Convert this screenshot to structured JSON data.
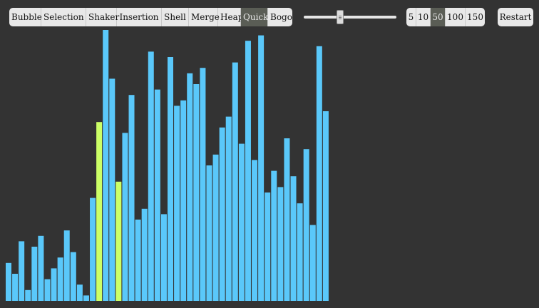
{
  "algorithms": [
    "Bubble",
    "Selection",
    "Shaker",
    "Insertion",
    "Shell",
    "Merge",
    "Heap",
    "Quick",
    "Bogo"
  ],
  "active_algorithm": "Quick",
  "sizes": [
    "5",
    "10",
    "50",
    "100",
    "150"
  ],
  "active_size": "50",
  "restart_label": "Restart",
  "speed_fraction": 0.39,
  "colors": {
    "background": "#333333",
    "bar": "#5ac8fa",
    "bar_highlight": "#ccff66"
  },
  "chart_data": {
    "type": "bar",
    "count": 50,
    "max_value": 100,
    "highlighted_indices": [
      14,
      17
    ],
    "values": [
      14,
      10,
      22,
      4,
      20,
      24,
      8,
      12,
      16,
      26,
      18,
      6,
      2,
      38,
      66,
      100,
      82,
      44,
      62,
      76,
      30,
      34,
      92,
      78,
      32,
      90,
      72,
      74,
      84,
      80,
      86,
      50,
      54,
      64,
      68,
      88,
      58,
      96,
      52,
      98,
      40,
      48,
      42,
      60,
      46,
      36,
      56,
      28,
      94,
      70
    ]
  }
}
